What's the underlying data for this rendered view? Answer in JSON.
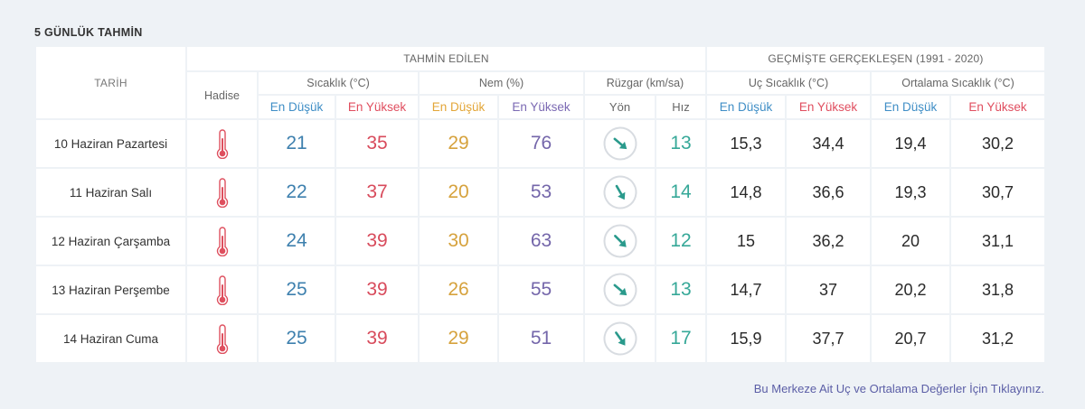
{
  "section_title": "5 GÜNLÜK TAHMİN",
  "headers": {
    "date": "TARİH",
    "forecast_group": "TAHMİN EDİLEN",
    "history_group": "GEÇMİŞTE GERÇEKLEŞEN (1991 - 2020)",
    "event": "Hadise",
    "temperature": "Sıcaklık (°C)",
    "humidity": "Nem (%)",
    "wind": "Rüzgar (km/sa)",
    "extreme_temperature": "Uç Sıcaklık (°C)",
    "average_temperature": "Ortalama Sıcaklık (°C)",
    "sub": [
      "En Düşük",
      "En Yüksek",
      "En Düşük",
      "En Yüksek",
      "Yön",
      "Hız",
      "En Düşük",
      "En Yüksek",
      "En Düşük",
      "En Yüksek"
    ]
  },
  "rows": [
    {
      "date": "10 Haziran Pazartesi",
      "event_icon": "thermometer-icon",
      "temp_min": "21",
      "temp_max": "35",
      "humidity_min": "29",
      "humidity_max": "76",
      "wind_icon": "wind-direction-icon",
      "wind_direction_deg": 130,
      "wind_speed": "13",
      "extreme_min": "15,3",
      "extreme_max": "34,4",
      "average_min": "19,4",
      "average_max": "30,2"
    },
    {
      "date": "11 Haziran Salı",
      "event_icon": "thermometer-icon",
      "temp_min": "22",
      "temp_max": "37",
      "humidity_min": "20",
      "humidity_max": "53",
      "wind_icon": "wind-direction-icon",
      "wind_direction_deg": 150,
      "wind_speed": "14",
      "extreme_min": "14,8",
      "extreme_max": "36,6",
      "average_min": "19,3",
      "average_max": "30,7"
    },
    {
      "date": "12 Haziran Çarşamba",
      "event_icon": "thermometer-icon",
      "temp_min": "24",
      "temp_max": "39",
      "humidity_min": "30",
      "humidity_max": "63",
      "wind_icon": "wind-direction-icon",
      "wind_direction_deg": 135,
      "wind_speed": "12",
      "extreme_min": "15",
      "extreme_max": "36,2",
      "average_min": "20",
      "average_max": "31,1"
    },
    {
      "date": "13 Haziran Perşembe",
      "event_icon": "thermometer-icon",
      "temp_min": "25",
      "temp_max": "39",
      "humidity_min": "26",
      "humidity_max": "55",
      "wind_icon": "wind-direction-icon",
      "wind_direction_deg": 130,
      "wind_speed": "13",
      "extreme_min": "14,7",
      "extreme_max": "37",
      "average_min": "20,2",
      "average_max": "31,8"
    },
    {
      "date": "14 Haziran Cuma",
      "event_icon": "thermometer-icon",
      "temp_min": "25",
      "temp_max": "39",
      "humidity_min": "29",
      "humidity_max": "51",
      "wind_icon": "wind-direction-icon",
      "wind_direction_deg": 145,
      "wind_speed": "17",
      "extreme_min": "15,9",
      "extreme_max": "37,7",
      "average_min": "20,7",
      "average_max": "31,2"
    }
  ],
  "footer_link": "Bu Merkeze Ait Uç ve Ortalama Değerler İçin Tıklayınız.",
  "colors": {
    "temp_min": "#3e80ae",
    "temp_max": "#d84b5c",
    "hum_min": "#d6a23d",
    "hum_max": "#7466aa",
    "wind_speed": "#36a898",
    "wind_arrow": "#2a9a8c",
    "history": "#2a2a2a",
    "link": "#5b5ea6",
    "thermo": "#de4f5e",
    "label_min": "#3f8ec6",
    "label_max": "#e04e5f",
    "label_hum_min": "#e3a638",
    "label_hum_max": "#7b69b3",
    "page_bg": "#eef2f6",
    "header_text": "#666666"
  }
}
